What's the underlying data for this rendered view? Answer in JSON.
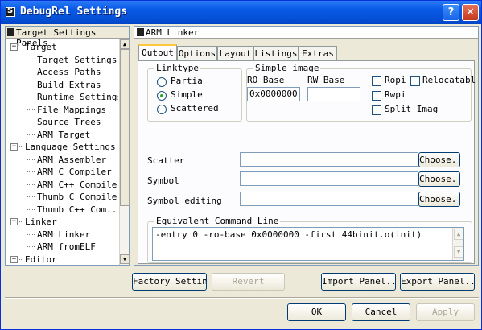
{
  "window": {
    "title": "DebugRel Settings",
    "help_label": "?",
    "close_label": "✕"
  },
  "left_panel": {
    "header": "Target Settings Panels",
    "tree": [
      {
        "label": "Target",
        "level": 0,
        "expanded": true
      },
      {
        "label": "Target Settings",
        "level": 1
      },
      {
        "label": "Access Paths",
        "level": 1
      },
      {
        "label": "Build Extras",
        "level": 1
      },
      {
        "label": "Runtime Settings",
        "level": 1
      },
      {
        "label": "File Mappings",
        "level": 1
      },
      {
        "label": "Source Trees",
        "level": 1
      },
      {
        "label": "ARM Target",
        "level": 1
      },
      {
        "label": "Language Settings",
        "level": 0,
        "expanded": true
      },
      {
        "label": "ARM Assembler",
        "level": 1
      },
      {
        "label": "ARM C Compiler",
        "level": 1
      },
      {
        "label": "ARM C++ Compiler",
        "level": 1
      },
      {
        "label": "Thumb C Compiler",
        "level": 1
      },
      {
        "label": "Thumb C++ Com...",
        "level": 1
      },
      {
        "label": "Linker",
        "level": 0,
        "expanded": true
      },
      {
        "label": "ARM Linker",
        "level": 1
      },
      {
        "label": "ARM fromELF",
        "level": 1
      },
      {
        "label": "Editor",
        "level": 0,
        "expanded": true
      }
    ]
  },
  "right_panel": {
    "header": "ARM Linker",
    "tabs": [
      {
        "label": "Output",
        "active": true
      },
      {
        "label": "Options"
      },
      {
        "label": "Layout"
      },
      {
        "label": "Listings"
      },
      {
        "label": "Extras"
      }
    ],
    "linktype": {
      "legend": "Linktype",
      "options": [
        {
          "label": "Partia",
          "selected": false
        },
        {
          "label": "Simple",
          "selected": true
        },
        {
          "label": "Scattered",
          "selected": false
        }
      ]
    },
    "simple_image": {
      "legend": "Simple image",
      "ro_base_label": "RO Base",
      "ro_base_value": "0x0000000",
      "rw_base_label": "RW Base",
      "rw_base_value": "",
      "checks": [
        {
          "label": "Ropi",
          "checked": false
        },
        {
          "label": "Relocatabl",
          "checked": false
        },
        {
          "label": "Rwpi",
          "checked": false
        },
        {
          "label": "Split Imag",
          "checked": false
        }
      ]
    },
    "files": [
      {
        "label": "Scatter",
        "value": "",
        "button": "Choose..."
      },
      {
        "label": "Symbol",
        "value": "",
        "button": "Choose..."
      },
      {
        "label": "Symbol editing",
        "value": "",
        "button": "Choose..."
      }
    ],
    "cmdline": {
      "legend": "Equivalent Command Line",
      "text": "-entry 0 -ro-base 0x0000000 -first 44binit.o(init)"
    }
  },
  "actions": {
    "factory": "Factory Settings",
    "revert": "Revert",
    "import": "Import Panel...",
    "export": "Export Panel..."
  },
  "dialog": {
    "ok": "OK",
    "cancel": "Cancel",
    "apply": "Apply"
  }
}
